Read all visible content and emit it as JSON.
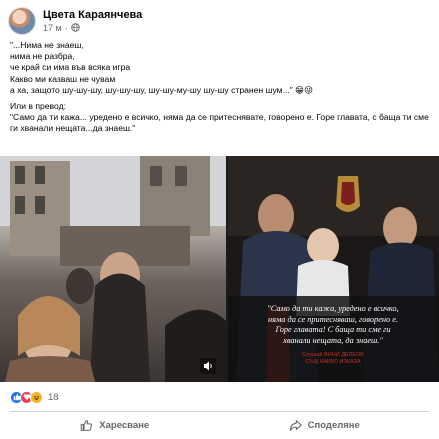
{
  "post": {
    "author": "Цвета Караянчева",
    "time": "17 м",
    "separator": "·",
    "lines": [
      "\"...Нима не знаеш,",
      "нима не разбра,",
      "че край си има във всяка игра",
      "Какво ми казваш не чувам",
      "а ха, защото шу-шу-шу,  шу-шу-шу, шу-шу-му-шу шу-шу странен шум...\" 😁😜"
    ],
    "translation_intro": "Или в превод:",
    "translation": "\"Само да ти кажа... уредено е всичко, няма да се притеснявате, говорено е. Горе главата, с баща ти сме ги хванали нещата...да знаеш.\""
  },
  "media": {
    "caption_lines": [
      "\"Само да ти кажа, уредено е всичко,",
      "няма да се притесняваш, говорено е.",
      "Горе главата! С баща ти сме ги",
      "хванали нещата, да знаеш.\""
    ],
    "credit_lines": [
      "Слушай ВИНИ ДЕЛЕОВ",
      "СЪЩ КАКВО ИЗКАЗА"
    ]
  },
  "reactions": {
    "count": "18",
    "icons": [
      "like-icon",
      "love-icon",
      "haha-icon"
    ],
    "colors": {
      "like": "#1877f2",
      "love": "#f33e58",
      "haha": "#f7b125"
    }
  },
  "actions": {
    "like_label": "Харесване",
    "share_label": "Споделяне"
  }
}
